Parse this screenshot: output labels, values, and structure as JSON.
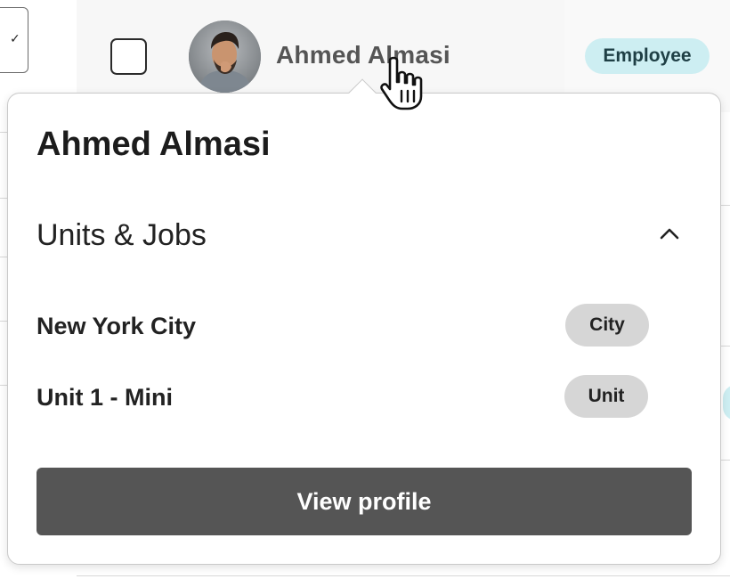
{
  "row": {
    "user_name": "Ahmed Almasi",
    "role_badge": "Employee"
  },
  "popover": {
    "title": "Ahmed Almasi",
    "section": {
      "title": "Units & Jobs",
      "toggle_icon": "chevron-up-icon",
      "expanded": true
    },
    "units": [
      {
        "name": "New York City",
        "tag": "City"
      },
      {
        "name": "Unit 1 - Mini",
        "tag": "Unit"
      }
    ],
    "view_profile_label": "View profile"
  },
  "colors": {
    "role_badge_bg": "#cdeef2",
    "tag_bg": "#d6d6d6",
    "button_bg": "#555555"
  }
}
